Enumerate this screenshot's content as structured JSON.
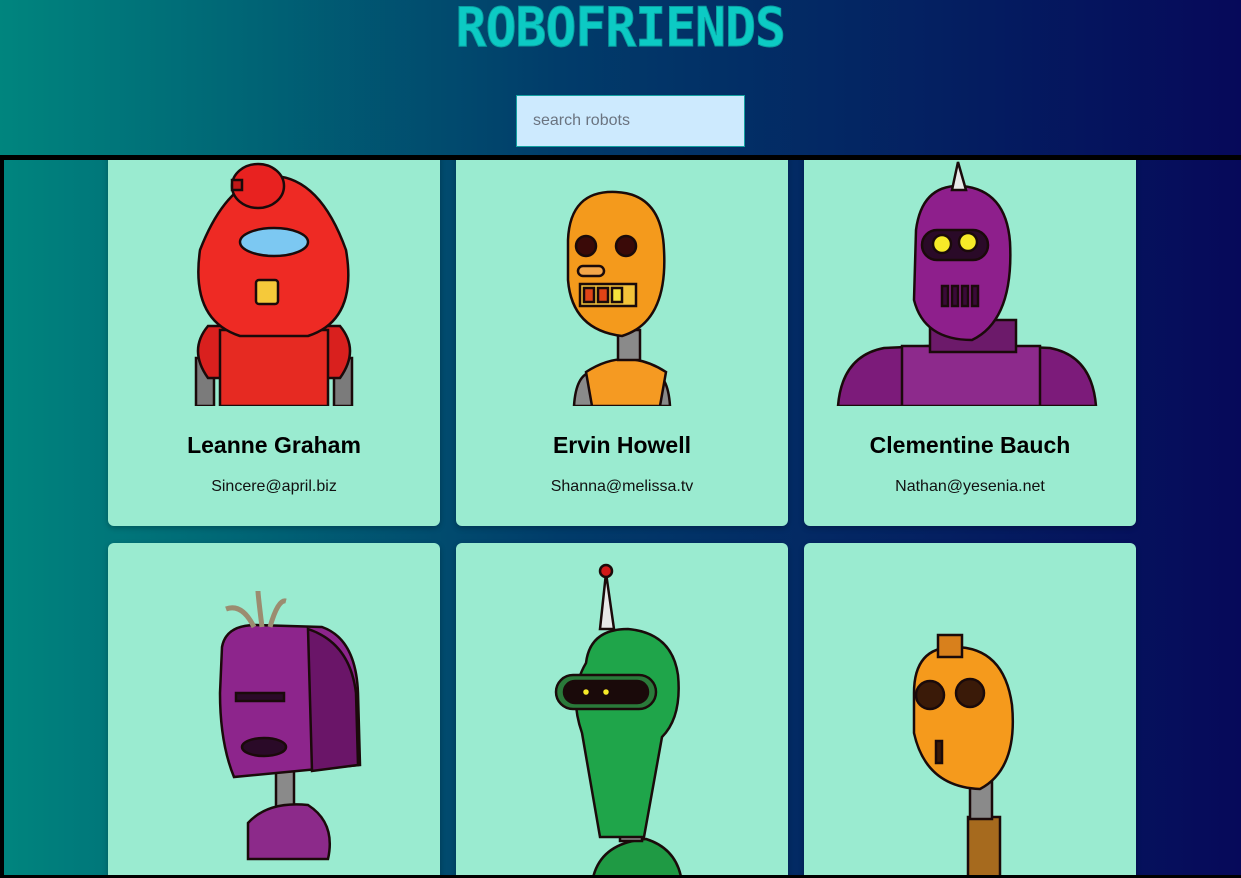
{
  "app": {
    "title": "ROBOFRIENDS"
  },
  "search": {
    "placeholder": "search robots",
    "value": ""
  },
  "colors": {
    "card_background": "#9aebd0",
    "logo": "#0ccac4",
    "search_background": "#cdeafe"
  },
  "robots": [
    {
      "name": "Leanne Graham",
      "email": "Sincere@april.biz",
      "robot_color": "red"
    },
    {
      "name": "Ervin Howell",
      "email": "Shanna@melissa.tv",
      "robot_color": "orange"
    },
    {
      "name": "Clementine Bauch",
      "email": "Nathan@yesenia.net",
      "robot_color": "purple"
    },
    {
      "name": "",
      "email": "",
      "robot_color": "purple"
    },
    {
      "name": "",
      "email": "",
      "robot_color": "green"
    },
    {
      "name": "",
      "email": "",
      "robot_color": "orange"
    }
  ]
}
